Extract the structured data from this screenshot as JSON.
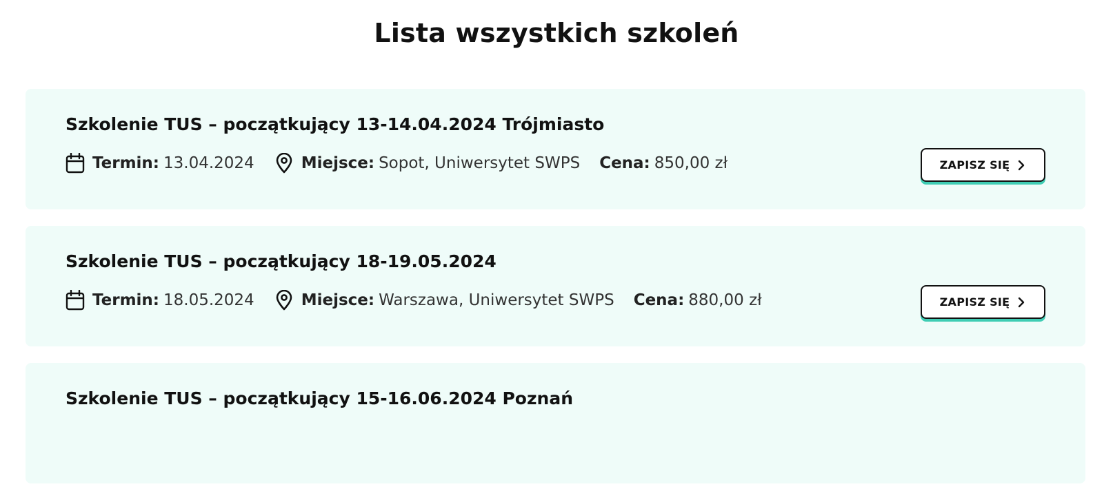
{
  "page": {
    "title": "Lista wszystkich szkoleń"
  },
  "labels": {
    "term": "Termin:",
    "place": "Miejsce:",
    "price": "Cena:",
    "signup": "ZAPISZ SIĘ"
  },
  "colors": {
    "card_background": "#effcf9",
    "button_accent": "#3fcdb4",
    "text": "#111111"
  },
  "icons": {
    "term": "calendar-icon",
    "place": "map-pin-icon",
    "button": "chevron-right-icon"
  },
  "trainings": [
    {
      "title": "Szkolenie TUS – początkujący 13-14.04.2024 Trójmiasto",
      "term": "13.04.2024",
      "place": "Sopot, Uniwersytet SWPS",
      "price": "850,00 zł"
    },
    {
      "title": "Szkolenie TUS – początkujący 18-19.05.2024",
      "term": "18.05.2024",
      "place": "Warszawa, Uniwersytet SWPS",
      "price": "880,00 zł"
    },
    {
      "title": "Szkolenie TUS – początkujący 15-16.06.2024 Poznań",
      "term": "",
      "place": "",
      "price": ""
    }
  ]
}
